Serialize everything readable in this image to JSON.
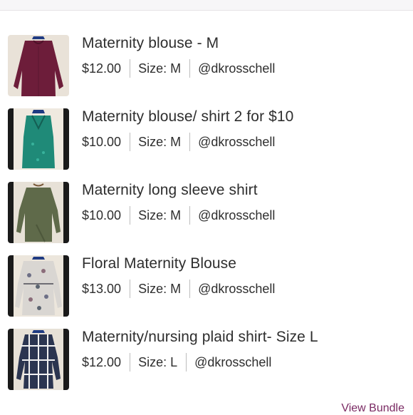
{
  "items": [
    {
      "title": "Maternity blouse - M",
      "price": "$12.00",
      "size": "Size: M",
      "seller": "@dkrosschell",
      "image": "burgundy-blouse-photo"
    },
    {
      "title": "Maternity blouse/ shirt 2 for $10",
      "price": "$10.00",
      "size": "Size: M",
      "seller": "@dkrosschell",
      "image": "teal-blouse-photo"
    },
    {
      "title": "Maternity long sleeve shirt",
      "price": "$10.00",
      "size": "Size: M",
      "seller": "@dkrosschell",
      "image": "olive-shirt-photo"
    },
    {
      "title": "Floral Maternity Blouse",
      "price": "$13.00",
      "size": "Size: M",
      "seller": "@dkrosschell",
      "image": "floral-blouse-photo"
    },
    {
      "title": "Maternity/nursing plaid shirt- Size L",
      "price": "$12.00",
      "size": "Size: L",
      "seller": "@dkrosschell",
      "image": "plaid-shirt-photo"
    }
  ],
  "footer": {
    "view_bundle_label": "View Bundle"
  },
  "colors": {
    "accent": "#7a2a63",
    "text": "#2e2e2e",
    "separator": "#bdbdbd"
  }
}
